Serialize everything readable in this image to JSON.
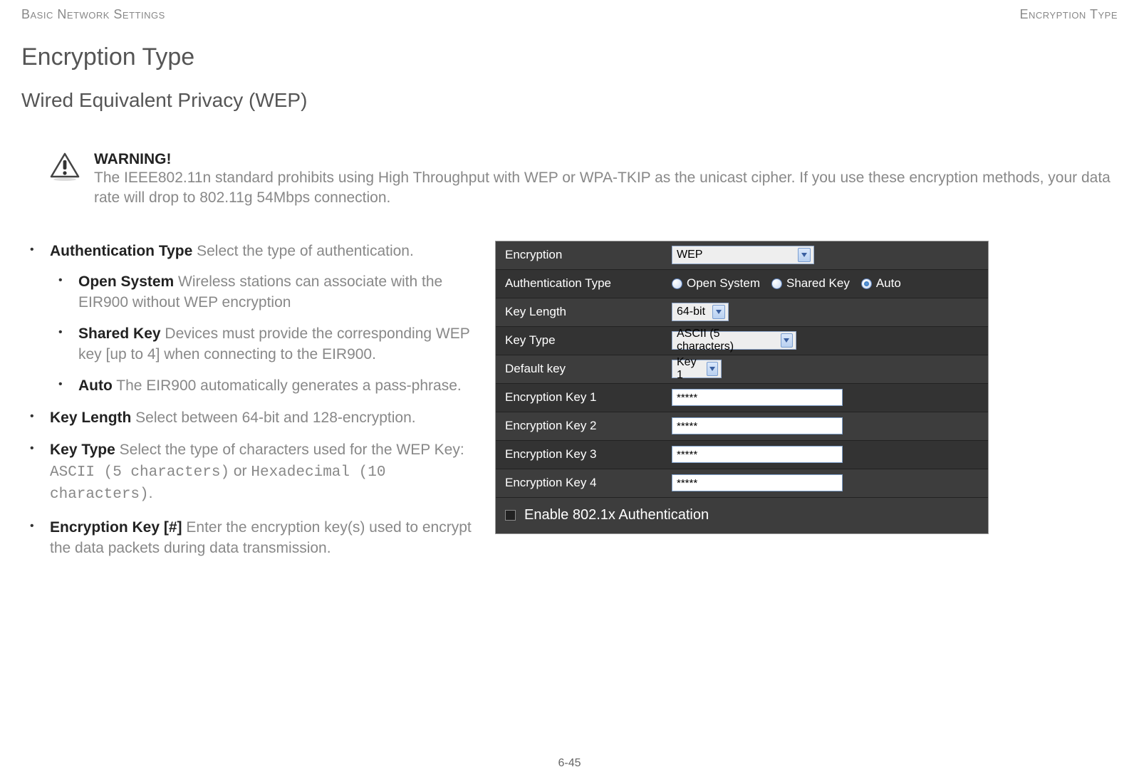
{
  "header": {
    "left": "Basic Network Settings",
    "right": "Encryption Type"
  },
  "title": "Encryption Type",
  "subtitle": "Wired Equivalent Privacy (WEP)",
  "warning": {
    "label": "WARNING!",
    "body": "The IEEE802.11n standard prohibits using High Throughput with WEP or WPA-TKIP as the unicast cipher. If you use these encryption methods, your data rate will drop to 802.11g 54Mbps connection."
  },
  "bullets": {
    "auth": {
      "term": "Authentication Type",
      "desc": "  Select the type of authentication."
    },
    "open": {
      "term": "Open System",
      "desc": "  Wireless stations can associate with the EIR900 without WEP encryption"
    },
    "shared": {
      "term": "Shared Key",
      "desc": "  Devices must provide the corresponding WEP key [up to 4] when connecting to the EIR900."
    },
    "auto": {
      "term": "Auto",
      "desc": "  The EIR900 automatically generates a pass-phrase."
    },
    "keylen": {
      "term": "Key Length",
      "desc": "  Select between 64-bit and 128-encryption."
    },
    "keytype": {
      "term": "Key Type",
      "desc_pre": "  Select the type of characters used for the WEP Key: ",
      "opt1": "ASCII (5 characters)",
      "mid": " or ",
      "opt2": "Hexadecimal (10 characters)",
      "post": "."
    },
    "enckey": {
      "term": "Encryption Key [#]",
      "desc": "  Enter the encryption key(s) used to encrypt the data packets during data transmission."
    }
  },
  "panel": {
    "rows": {
      "encryption": {
        "label": "Encryption",
        "value": "WEP"
      },
      "authtype": {
        "label": "Authentication Type",
        "options": {
          "open": "Open System",
          "shared": "Shared Key",
          "auto": "Auto"
        },
        "selected": "auto"
      },
      "keylength": {
        "label": "Key Length",
        "value": "64-bit"
      },
      "keytype": {
        "label": "Key Type",
        "value": "ASCII (5 characters)"
      },
      "defaultkey": {
        "label": "Default key",
        "value": "Key 1"
      },
      "ek1": {
        "label": "Encryption Key 1",
        "value": "*****"
      },
      "ek2": {
        "label": "Encryption Key 2",
        "value": "*****"
      },
      "ek3": {
        "label": "Encryption Key 3",
        "value": "*****"
      },
      "ek4": {
        "label": "Encryption Key 4",
        "value": "*****"
      }
    },
    "footer": {
      "label": "Enable 802.1x Authentication"
    }
  },
  "page_number": "6-45"
}
